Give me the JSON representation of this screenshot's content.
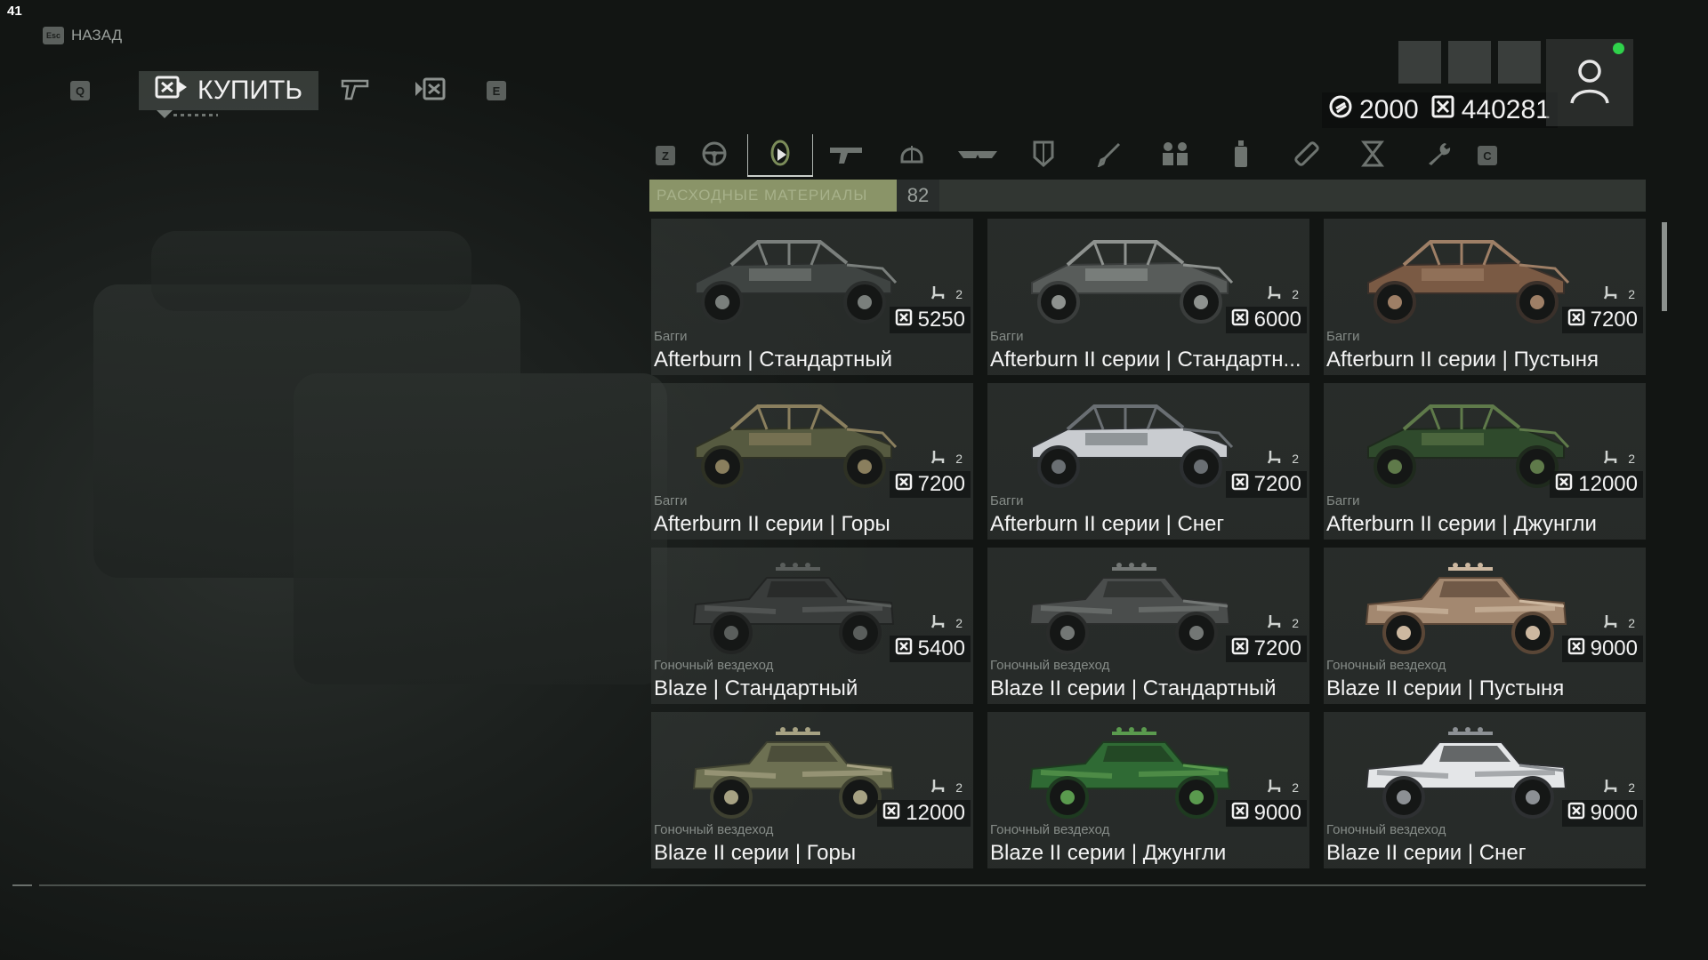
{
  "overlay": {
    "fps": "41"
  },
  "nav": {
    "back_key": "Esc",
    "back_label": "НАЗАД"
  },
  "mode_tabs": {
    "prev_key": "Q",
    "next_key": "E",
    "active_label": "КУПИТЬ"
  },
  "currency": {
    "premium": "2000",
    "credits": "440281"
  },
  "categories": {
    "prev_key": "Z",
    "next_key": "C",
    "active_label": "РАСХОДНЫЕ МАТЕРИАЛЫ",
    "active_count": "82",
    "icons": [
      "steering-wheel-icon",
      "consumables-icon",
      "rifle-icon",
      "helmet-icon",
      "goggles-icon",
      "armor-icon",
      "knife-icon",
      "squad-icon",
      "bottle-icon",
      "bandage-icon",
      "hourglass-icon",
      "wrench-icon"
    ]
  },
  "items": [
    {
      "type": "Багги",
      "name": "Afterburn | Стандартный",
      "seats": "2",
      "price": "5250",
      "vehicle": "buggy",
      "colors": [
        "#3f4442",
        "#7a7f7c",
        "#2a2d2c"
      ]
    },
    {
      "type": "Багги",
      "name": "Afterburn II серии | Стандартн...",
      "seats": "2",
      "price": "6000",
      "vehicle": "buggy",
      "colors": [
        "#585c5a",
        "#8e928f",
        "#3a3d3c"
      ]
    },
    {
      "type": "Багги",
      "name": "Afterburn II серии | Пустыня",
      "seats": "2",
      "price": "7200",
      "vehicle": "buggy",
      "colors": [
        "#7a5a44",
        "#9e7f66",
        "#3a302a"
      ]
    },
    {
      "type": "Багги",
      "name": "Afterburn II серии | Горы",
      "seats": "2",
      "price": "7200",
      "vehicle": "buggy",
      "colors": [
        "#565a40",
        "#8a7f5e",
        "#2e3124"
      ]
    },
    {
      "type": "Багги",
      "name": "Afterburn II серии | Снег",
      "seats": "2",
      "price": "7200",
      "vehicle": "buggy",
      "colors": [
        "#c9ccd0",
        "#6a6f73",
        "#2c2f31"
      ]
    },
    {
      "type": "Багги",
      "name": "Afterburn II серии | Джунгли",
      "seats": "2",
      "price": "12000",
      "vehicle": "buggy",
      "colors": [
        "#2f4a2c",
        "#5f7a4a",
        "#1f2a1d"
      ]
    },
    {
      "type": "Гоночный вездеход",
      "name": "Blaze | Стандартный",
      "seats": "2",
      "price": "5400",
      "vehicle": "truck",
      "colors": [
        "#393c3b",
        "#5a5e5c",
        "#222423"
      ]
    },
    {
      "type": "Гоночный вездеход",
      "name": "Blaze II серии | Стандартный",
      "seats": "2",
      "price": "7200",
      "vehicle": "truck",
      "colors": [
        "#4a4d4c",
        "#737775",
        "#2a2c2b"
      ]
    },
    {
      "type": "Гоночный вездеход",
      "name": "Blaze II серии | Пустыня",
      "seats": "2",
      "price": "9000",
      "vehicle": "truck",
      "colors": [
        "#a38870",
        "#cdb8a0",
        "#5a4636"
      ]
    },
    {
      "type": "Гоночный вездеход",
      "name": "Blaze II серии | Горы",
      "seats": "2",
      "price": "12000",
      "vehicle": "truck",
      "colors": [
        "#6d7052",
        "#a7a283",
        "#3e4030"
      ]
    },
    {
      "type": "Гоночный вездеход",
      "name": "Blaze II серии | Джунгли",
      "seats": "2",
      "price": "9000",
      "vehicle": "truck",
      "colors": [
        "#2f6a34",
        "#5a9a4e",
        "#1e3a20"
      ]
    },
    {
      "type": "Гоночный вездеход",
      "name": "Blaze II серии | Снег",
      "seats": "2",
      "price": "9000",
      "vehicle": "truck",
      "colors": [
        "#e4e6e8",
        "#8c9094",
        "#2e3032"
      ]
    }
  ]
}
